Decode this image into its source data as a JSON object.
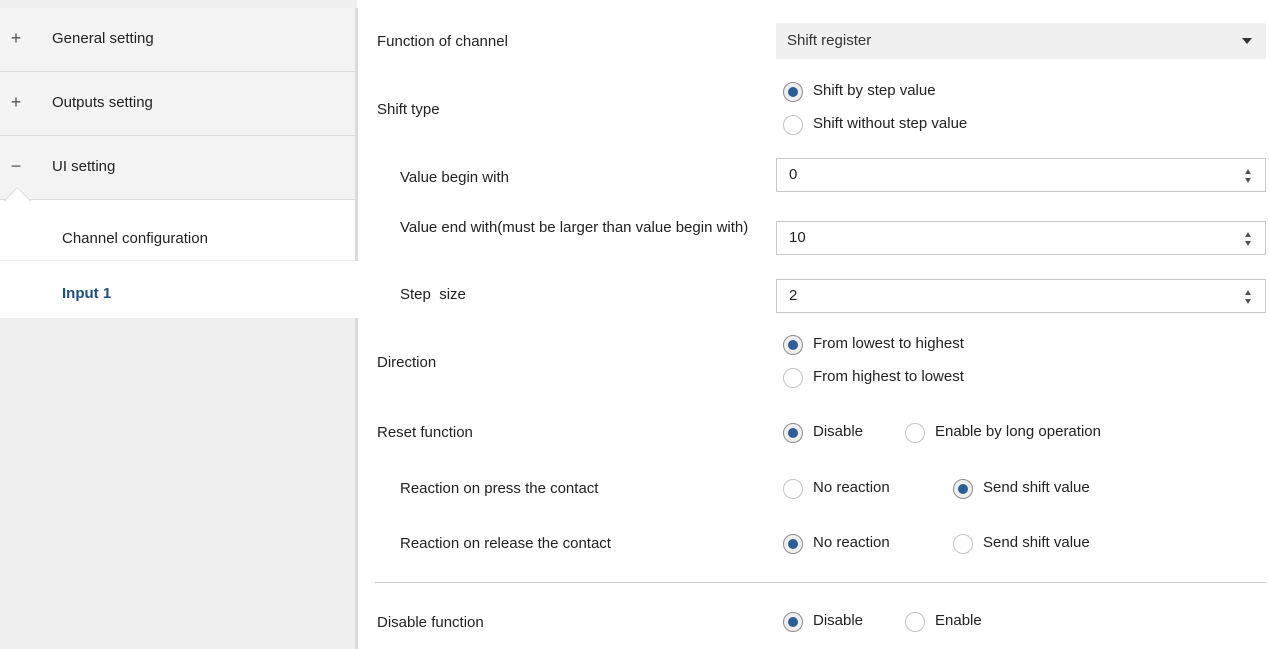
{
  "sidebar": {
    "items": [
      {
        "sign": "+",
        "label": "General setting"
      },
      {
        "sign": "+",
        "label": "Outputs setting"
      },
      {
        "sign": "−",
        "label": "UI setting"
      }
    ],
    "subitems": [
      {
        "label": "Channel configuration",
        "selected": false
      },
      {
        "label": "Input 1",
        "selected": true
      }
    ],
    "colors": {
      "selected_text": "#1f4f7f"
    }
  },
  "main": {
    "function_of_channel": {
      "label": "Function of channel",
      "value": "Shift register"
    },
    "shift_type": {
      "label": "Shift type",
      "options": [
        "Shift by step value",
        "Shift without step value"
      ],
      "selected": 0
    },
    "value_begin": {
      "label": "Value begin with",
      "value": "0"
    },
    "value_end": {
      "label": "Value end with(must be larger than value begin with)",
      "value": "10"
    },
    "step_size": {
      "label": "Step  size",
      "value": "2"
    },
    "direction": {
      "label": "Direction",
      "options": [
        "From lowest to highest",
        "From highest to lowest"
      ],
      "selected": 0
    },
    "reset_function": {
      "label": "Reset function",
      "options": [
        "Disable",
        "Enable by long operation"
      ],
      "selected": 0
    },
    "reaction_press": {
      "label": "Reaction on press the contact",
      "options": [
        "No reaction",
        "Send shift value"
      ],
      "selected": 1
    },
    "reaction_release": {
      "label": "Reaction on release the contact",
      "options": [
        "No reaction",
        "Send shift value"
      ],
      "selected": 0
    },
    "disable_function": {
      "label": "Disable function",
      "options": [
        "Disable",
        "Enable"
      ],
      "selected": 0
    }
  }
}
